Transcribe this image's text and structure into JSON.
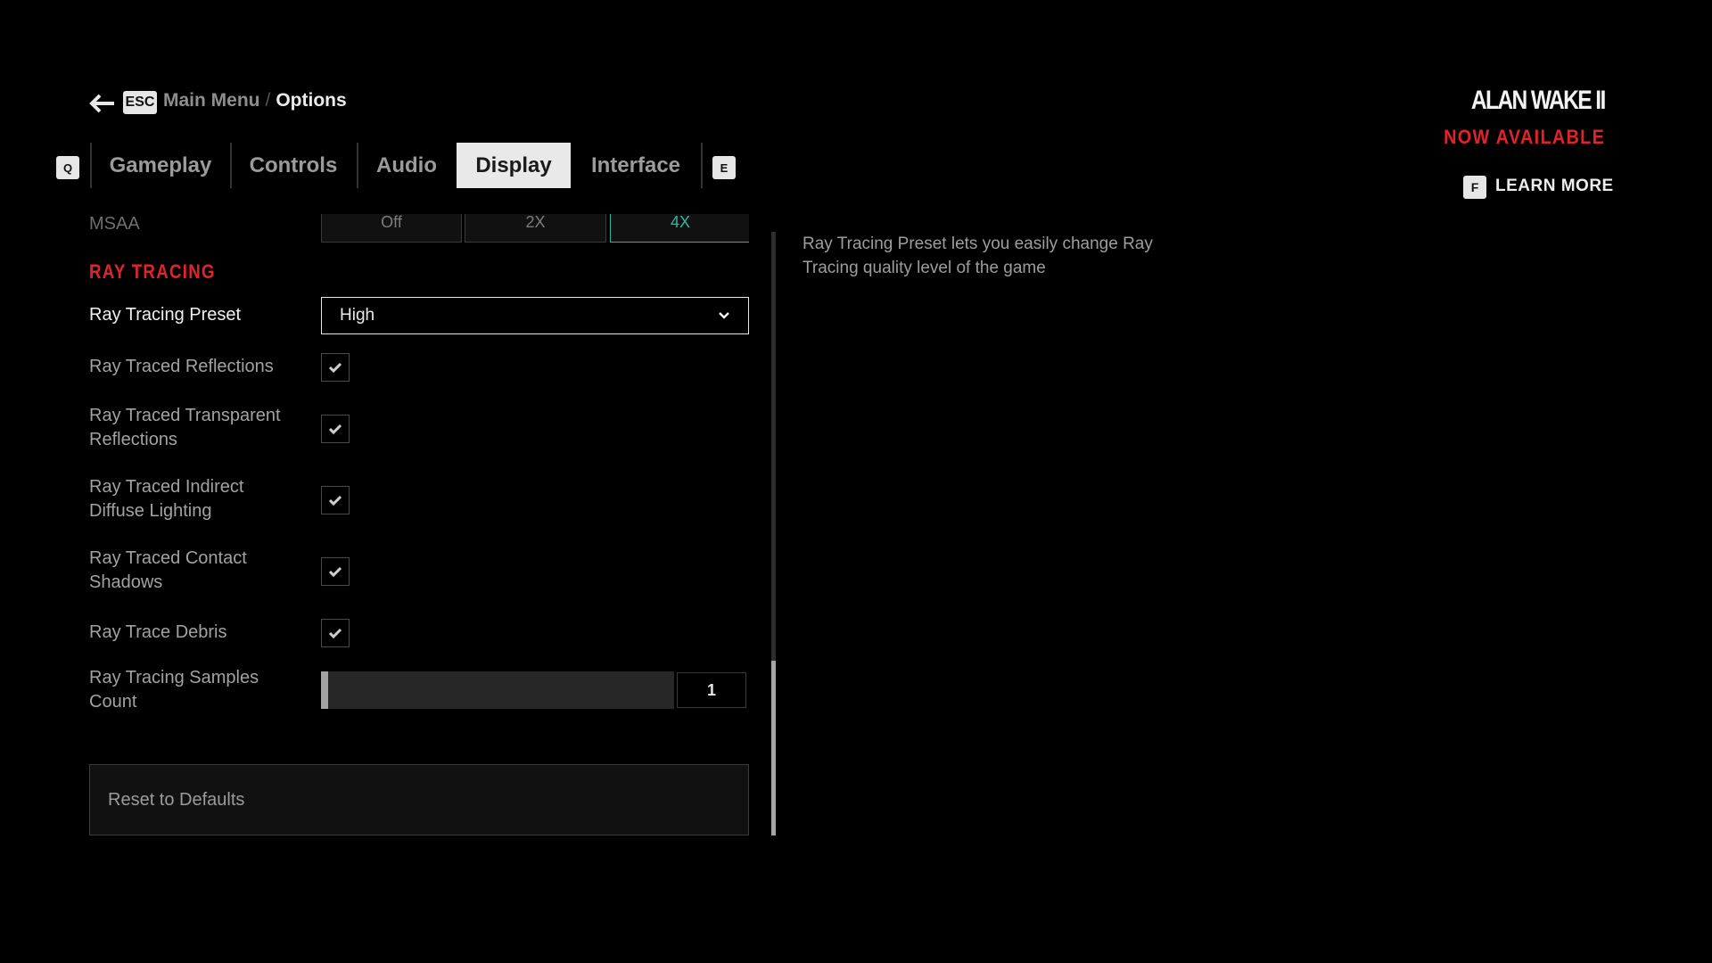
{
  "header": {
    "back_key": "ESC",
    "breadcrumb_prev": "Main Menu",
    "breadcrumb_sep": "/",
    "breadcrumb_current": "Options"
  },
  "tabs": {
    "prev_key": "Q",
    "next_key": "E",
    "items": [
      {
        "label": "Gameplay",
        "active": false
      },
      {
        "label": "Controls",
        "active": false
      },
      {
        "label": "Audio",
        "active": false
      },
      {
        "label": "Display",
        "active": true
      },
      {
        "label": "Interface",
        "active": false
      }
    ]
  },
  "promo": {
    "logo": "ALAN WAKE II",
    "tagline": "NOW AVAILABLE",
    "learn_key": "F",
    "learn_label": "LEARN MORE"
  },
  "settings": {
    "msaa": {
      "label": "MSAA",
      "options": [
        "Off",
        "2X",
        "4X"
      ],
      "selected": "4X"
    },
    "section_title": "RAY TRACING",
    "preset": {
      "label": "Ray Tracing Preset",
      "value": "High"
    },
    "checkboxes": [
      {
        "label": "Ray Traced Reflections",
        "checked": true
      },
      {
        "label": "Ray Traced Transparent Reflections",
        "checked": true
      },
      {
        "label": "Ray Traced Indirect Diffuse Lighting",
        "checked": true
      },
      {
        "label": "Ray Traced Contact Shadows",
        "checked": true
      },
      {
        "label": "Ray Trace Debris",
        "checked": true
      }
    ],
    "samples": {
      "label": "Ray Tracing Samples Count",
      "value": "1",
      "fill_fraction": 0.02
    },
    "reset_label": "Reset to Defaults"
  },
  "scrollbar": {
    "thumb_start_fraction": 0.71,
    "thumb_size_fraction": 0.29
  },
  "description": "Ray Tracing Preset lets you easily change Ray Tracing quality level of the game",
  "colors": {
    "accent_red": "#e0242a",
    "selected_teal": "#2fb79e"
  }
}
